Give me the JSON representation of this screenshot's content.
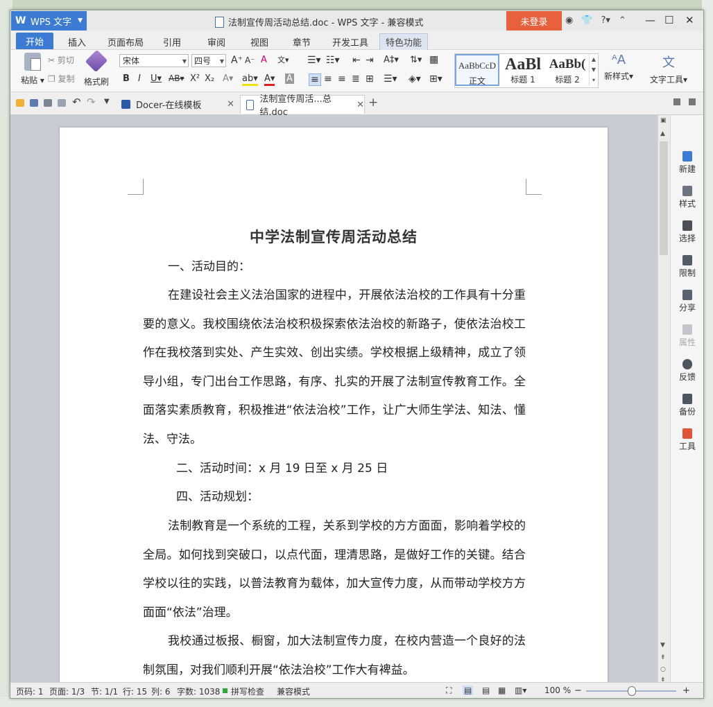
{
  "app": {
    "name": "WPS 文字",
    "doc_title": "法制宣传周活动总结.doc - WPS 文字 - 兼容模式",
    "login": "未登录"
  },
  "menu_tabs": [
    "开始",
    "插入",
    "页面布局",
    "引用",
    "审阅",
    "视图",
    "章节",
    "开发工具",
    "特色功能"
  ],
  "ribbon": {
    "paste": "粘贴",
    "cut": "剪切",
    "copy": "复制",
    "format_painter": "格式刷",
    "font": "宋体",
    "size": "四号",
    "styles": [
      {
        "sample": "AaBbCcD",
        "label": "正文"
      },
      {
        "sample": "AaBl",
        "label": "标题 1"
      },
      {
        "sample": "AaBb(",
        "label": "标题 2"
      }
    ],
    "new_style": "新样式",
    "text_tools": "文字工具"
  },
  "doc_tabs": [
    {
      "label": "Docer-在线模板"
    },
    {
      "label": "法制宣传周活...总结.doc"
    }
  ],
  "document": {
    "title": "中学法制宣传周活动总结",
    "paragraphs": [
      "一、活动目的：",
      "在建设社会主义法治国家的进程中，开展依法治校的工作具有十分重要的意义。我校围绕依法治校积极探索依法治校的新路子，使依法治校工作在我校落到实处、产生实效、创出实绩。学校根据上级精神，成立了领导小组，专门出台工作思路，有序、扎实的开展了法制宣传教育工作。全面落实素质教育，积极推进“依法治校”工作，让广大师生学法、知法、懂法、守法。",
      "二、活动时间：x 月 19 日至 x 月 25 日",
      "四、活动规划：",
      "法制教育是一个系统的工程，关系到学校的方方面面，影响着学校的全局。如何找到突破口，以点代面，理清思路，是做好工作的关键。结合学校以往的实践，以普法教育为载体，加大宣传力度，从而带动学校方方面面“依法”治理。",
      "我校通过板报、橱窗，加大法制宣传力度，在校内营造一个良好的法制氛围，对我们顺利开展“依法治校”工作大有裨益。"
    ]
  },
  "sidebar": [
    "新建",
    "样式",
    "选择",
    "限制",
    "分享",
    "属性",
    "反馈",
    "备份",
    "工具"
  ],
  "status": {
    "page": "页码: 1",
    "pages": "页面: 1/3",
    "section": "节: 1/1",
    "row": "行: 15",
    "col": "列: 6",
    "words": "字数: 1038",
    "spell": "拼写检查",
    "mode": "兼容模式",
    "zoom": "100 %"
  },
  "colors": {
    "accent": "#3b7bd4",
    "login": "#e8603c"
  }
}
